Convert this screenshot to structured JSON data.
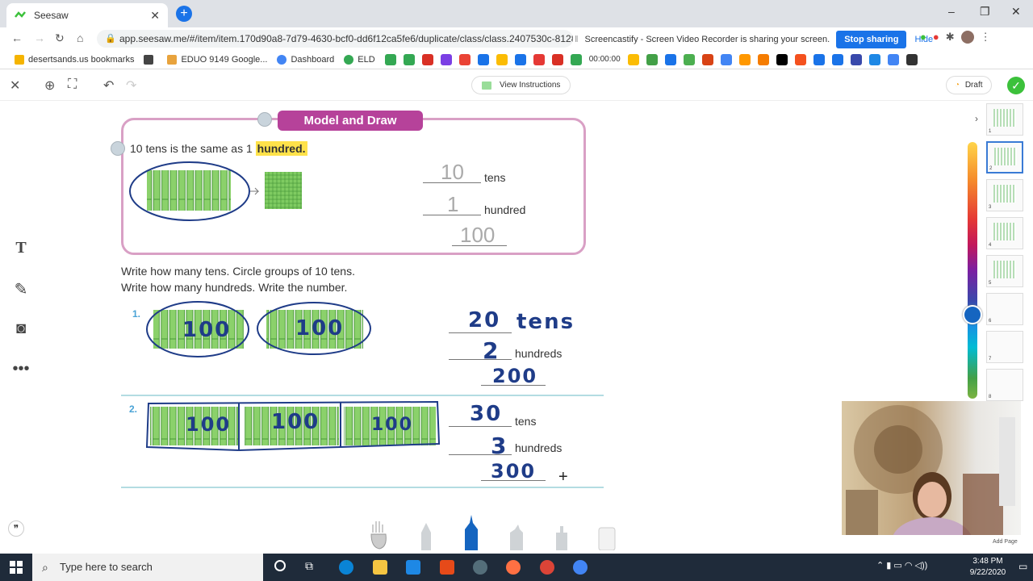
{
  "browser": {
    "tab_title": "Seesaw",
    "url": "app.seesaw.me/#/item/item.170d90a8-7d79-4630-bcf0-dd6f12ca5fe6/duplicate/class/class.2407530c-8128-4",
    "share_bar": {
      "message": "Screencastify - Screen Video Recorder is sharing your screen.",
      "stop_label": "Stop sharing",
      "hide_label": "Hide"
    },
    "bookmarks": [
      {
        "label": "desertsands.us bookmarks",
        "color": "#f5b400"
      },
      {
        "label": "",
        "color": "#444"
      },
      {
        "label": "EDUO 9149 Google...",
        "color": "#e8a33d"
      },
      {
        "label": "Dashboard",
        "color": "#4285f4"
      },
      {
        "label": "ELD",
        "color": "#34a853"
      }
    ],
    "ext_time": "00:00:00"
  },
  "toolbar": {
    "view_instructions": "View Instructions",
    "draft_label": "Draft"
  },
  "worksheet": {
    "title": "Model and Draw",
    "intro_text": "10 tens is the same as 1",
    "intro_highlight": "hundred.",
    "model": {
      "tens_value": "10",
      "tens_label": "tens",
      "hundred_value": "1",
      "hundred_label": "hundred",
      "number_value": "100"
    },
    "instruction_line1": "Write how many tens. Circle groups of 10 tens.",
    "instruction_line2": "Write how many hundreds. Write the number.",
    "problems": [
      {
        "number": "1.",
        "group_labels": [
          "100",
          "100"
        ],
        "tens_answer": "20",
        "tens_label": "tens",
        "hundreds_answer": "2",
        "hundreds_label": "hundreds",
        "number_answer": "200"
      },
      {
        "number": "2.",
        "group_labels": [
          "100",
          "100",
          "100"
        ],
        "tens_answer": "30",
        "tens_label": "tens",
        "hundreds_answer": "3",
        "hundreds_label": "hundreds",
        "number_answer": "300"
      }
    ]
  },
  "sidebar": {
    "pages": [
      "1",
      "2",
      "3",
      "4",
      "5",
      "6",
      "7",
      "8"
    ],
    "add_page": "Add Page"
  },
  "taskbar": {
    "search_placeholder": "Type here to search",
    "time": "3:48 PM",
    "date": "9/22/2020"
  }
}
